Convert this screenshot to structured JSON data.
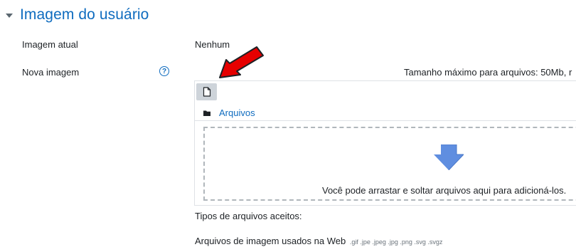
{
  "section": {
    "title": "Imagem do usuário"
  },
  "current_image": {
    "label": "Imagem atual",
    "value": "Nenhum"
  },
  "new_image": {
    "label": "Nova imagem",
    "help_icon": "question-circle-icon",
    "max_size": "Tamanho máximo para arquivos: 50Mb, r"
  },
  "filepicker": {
    "add_icon": "file-icon",
    "folder_icon": "folder-icon",
    "path_label": "Arquivos",
    "drop_icon": "arrow-down-icon",
    "drop_text": "Você pode arrastar e soltar arquivos aqui para adicioná-los."
  },
  "accepted": {
    "title": "Tipos de arquivos aceitos:",
    "group_label": "Arquivos de imagem usados na Web",
    "extensions": ".gif .jpe .jpeg .jpg .png .svg .svgz"
  },
  "colors": {
    "accent": "#0f6cbf",
    "annotation": "#e60000"
  }
}
